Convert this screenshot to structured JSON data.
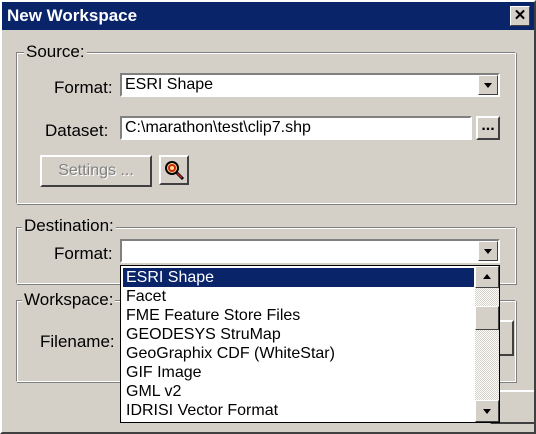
{
  "window": {
    "title": "New Workspace",
    "close_glyph": "✕"
  },
  "source": {
    "group_label": "Source:",
    "format_label": "Format:",
    "format_value": "ESRI Shape",
    "dataset_label": "Dataset:",
    "dataset_value": "C:\\marathon\\test\\clip7.shp",
    "browse_label": "...",
    "settings_label": "Settings ...",
    "settings_enabled": false,
    "preview_icon": "magnifier-icon"
  },
  "destination": {
    "group_label": "Destination:",
    "format_label": "Format:",
    "format_value": ""
  },
  "workspace": {
    "group_label": "Workspace:",
    "filename_label": "Filename:"
  },
  "format_dropdown": {
    "open": true,
    "selected": "ESRI Shape",
    "options": [
      "ESRI Shape",
      "Facet",
      "FME Feature Store Files",
      "GEODESYS StruMap",
      "GeoGraphix CDF (WhiteStar)",
      "GIF Image",
      "GML v2",
      "IDRISI Vector Format"
    ]
  },
  "colors": {
    "titlebar": "#0a246a",
    "face": "#d4d0c8",
    "selection": "#0a246a"
  }
}
